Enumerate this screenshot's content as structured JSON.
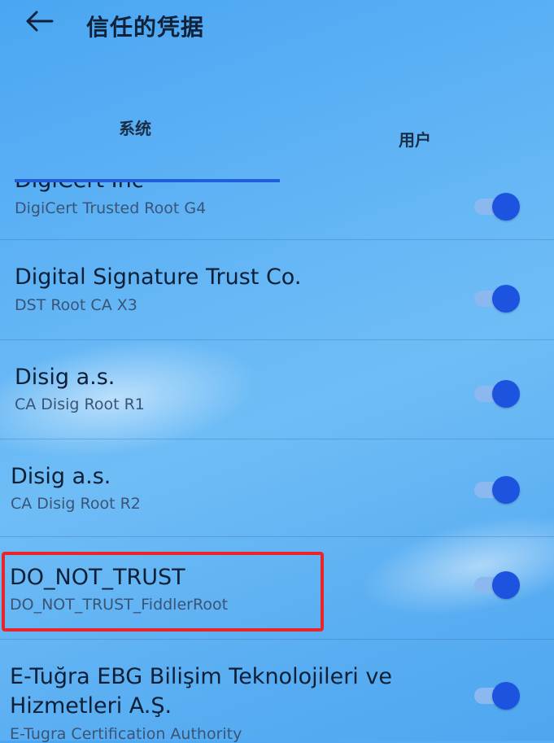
{
  "header": {
    "title": "信任的凭据"
  },
  "tabs": [
    {
      "label": "系统",
      "selected": true
    },
    {
      "label": "用户",
      "selected": false
    }
  ],
  "certificates": [
    {
      "title": "DigiCert Inc",
      "subtitle": "DigiCert Trusted Root G4",
      "enabled": true
    },
    {
      "title": "Digital Signature Trust Co.",
      "subtitle": "DST Root CA X3",
      "enabled": true
    },
    {
      "title": "Disig a.s.",
      "subtitle": "CA Disig Root R1",
      "enabled": true
    },
    {
      "title": "Disig a.s.",
      "subtitle": "CA Disig Root R2",
      "enabled": true
    },
    {
      "title": "DO_NOT_TRUST",
      "subtitle": "DO_NOT_TRUST_FiddlerRoot",
      "enabled": true,
      "highlighted": true
    },
    {
      "title": "E-Tuğra EBG Bilişim Teknolojileri ve",
      "title_line2": "Hizmetleri A.Ş.",
      "subtitle": "E-Tugra Certification Authority",
      "enabled": true
    }
  ],
  "colors": {
    "accent": "#1c54e0",
    "highlight": "#e8262a"
  },
  "icons": {
    "back": "arrow-left-icon"
  }
}
